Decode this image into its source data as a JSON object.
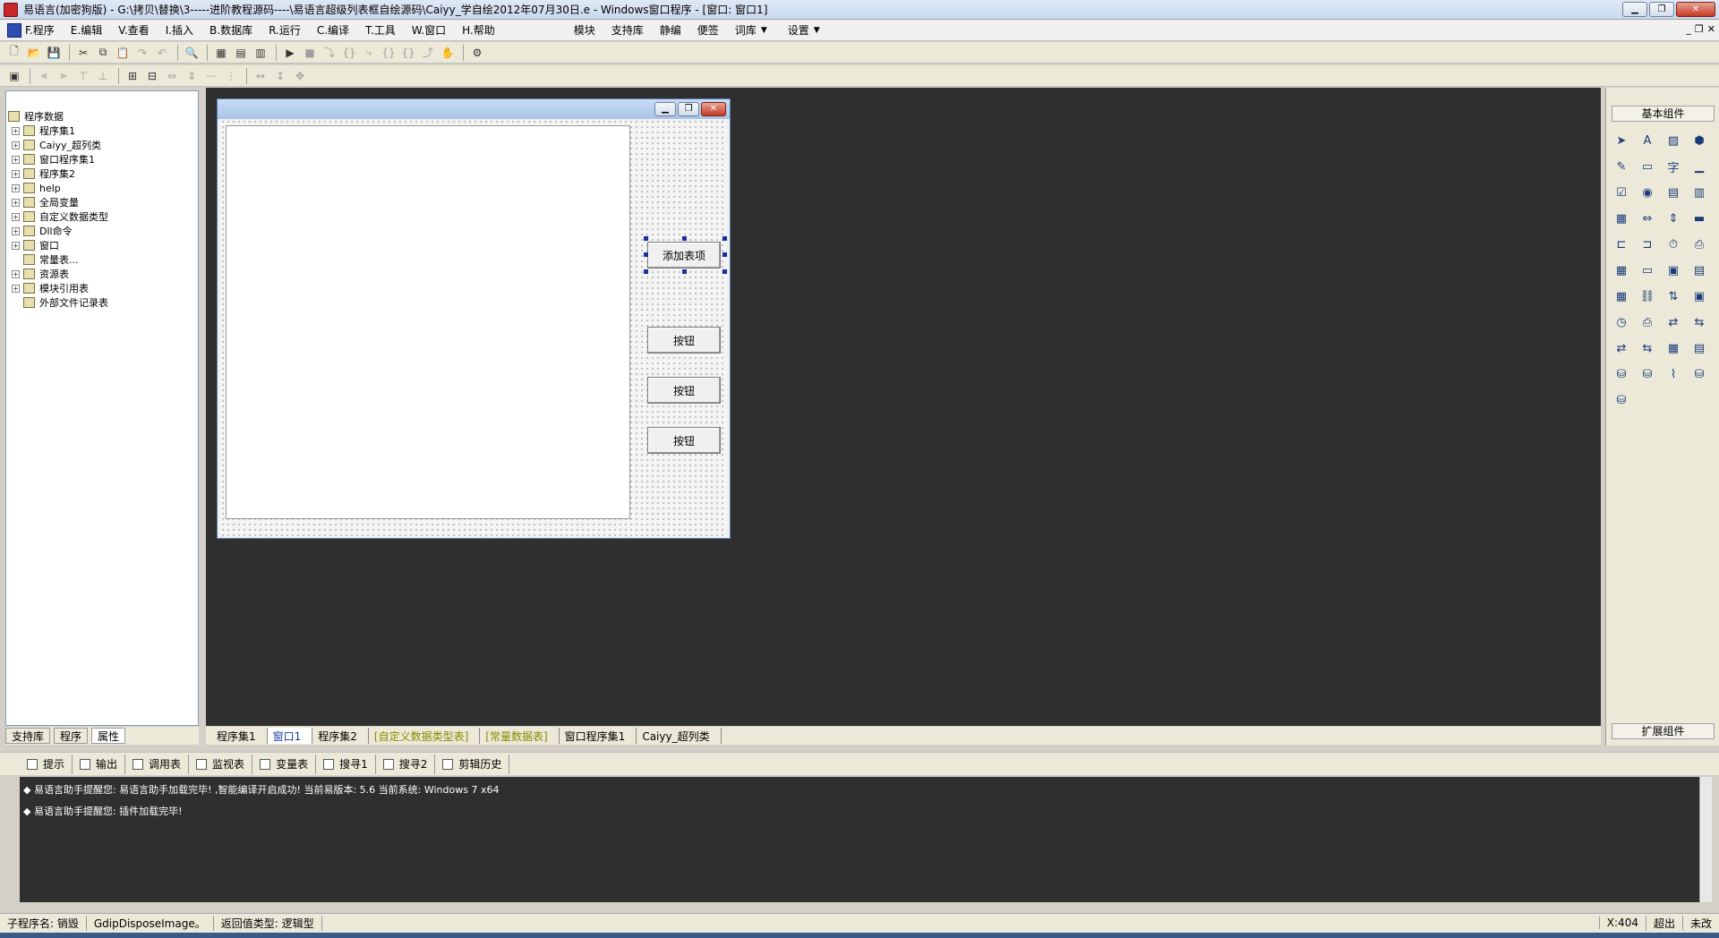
{
  "window": {
    "title": "易语言(加密狗版) - G:\\拷贝\\替换\\3-----进阶教程源码----\\易语言超级列表框自绘源码\\Caiyy_学自绘2012年07月30日.e - Windows窗口程序 - [窗口: 窗口1]"
  },
  "menubar": {
    "items": [
      "F.程序",
      "E.编辑",
      "V.查看",
      "I.插入",
      "B.数据库",
      "R.运行",
      "C.编译",
      "T.工具",
      "W.窗口",
      "H.帮助"
    ],
    "extra": [
      "模块",
      "支持库",
      "静编",
      "便签",
      "词库",
      "设置"
    ]
  },
  "tree": {
    "items": [
      {
        "label": "程序数据",
        "expander": false,
        "indent": 0
      },
      {
        "label": "程序集1",
        "expander": true,
        "indent": 1
      },
      {
        "label": "Caiyy_超列类",
        "expander": true,
        "indent": 1
      },
      {
        "label": "窗口程序集1",
        "expander": true,
        "indent": 1
      },
      {
        "label": "程序集2",
        "expander": true,
        "indent": 1
      },
      {
        "label": "help",
        "expander": true,
        "indent": 1
      },
      {
        "label": "全局变量",
        "expander": true,
        "indent": 1
      },
      {
        "label": "自定义数据类型",
        "expander": true,
        "indent": 1
      },
      {
        "label": "Dll命令",
        "expander": true,
        "indent": 1
      },
      {
        "label": "窗口",
        "expander": true,
        "indent": 1
      },
      {
        "label": "常量表...",
        "expander": false,
        "indent": 1
      },
      {
        "label": "资源表",
        "expander": true,
        "indent": 1
      },
      {
        "label": "模块引用表",
        "expander": true,
        "indent": 1
      },
      {
        "label": "外部文件记录表",
        "expander": false,
        "indent": 1
      }
    ]
  },
  "left_tabs": [
    "支持库",
    "程序",
    "属性"
  ],
  "form": {
    "add_button": "添加表项",
    "button1": "按钮",
    "button2": "按钮",
    "button3": "按钮"
  },
  "components": {
    "title": "基本组件",
    "footer": "扩展组件",
    "char_label": "字"
  },
  "editor_tabs": [
    {
      "label": "程序集1",
      "style": "normal"
    },
    {
      "label": "窗口1",
      "style": "on"
    },
    {
      "label": "程序集2",
      "style": "normal"
    },
    {
      "label": "[自定义数据类型表]",
      "style": "olive"
    },
    {
      "label": "[常量数据表]",
      "style": "olive"
    },
    {
      "label": "窗口程序集1",
      "style": "normal"
    },
    {
      "label": "Caiyy_超列类",
      "style": "normal"
    }
  ],
  "bottom_tabs": [
    "提示",
    "输出",
    "调用表",
    "监视表",
    "变量表",
    "搜寻1",
    "搜寻2",
    "剪辑历史"
  ],
  "output": {
    "line1": "◆ 易语言助手提醒您: 易语言助手加载完毕! ,智能编译开启成功! 当前易版本: 5.6 当前系统: Windows 7 x64",
    "line2": "◆ 易语言助手提醒您: 插件加载完毕!"
  },
  "status": {
    "sub_name": "子程序名: 销毁",
    "func": "GdipDisposeImage。",
    "ret": "返回值类型: 逻辑型",
    "coord": "X:404",
    "mode1": "超出",
    "mode2": "未改"
  }
}
